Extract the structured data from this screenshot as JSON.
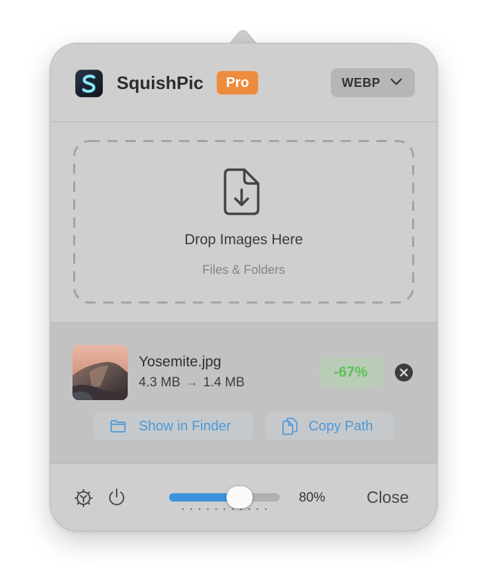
{
  "app": {
    "name": "SquishPic",
    "badge": "Pro",
    "icon": "squishpic-s-logo"
  },
  "format_menu": {
    "selected": "WEBP",
    "icon": "chevron-down-icon"
  },
  "drop_zone": {
    "icon": "document-download-icon",
    "title": "Drop Images Here",
    "subtitle": "Files & Folders"
  },
  "file": {
    "thumbnail": "mountain-photo-thumbnail",
    "name": "Yosemite.jpg",
    "original_size": "4.3 MB",
    "arrow": "→",
    "compressed_size": "1.4 MB",
    "reduction": "-67%"
  },
  "actions": {
    "show_in_finder": "Show in Finder",
    "copy_path": "Copy Path"
  },
  "footer": {
    "quality_value": 0.8,
    "quality_label": "80%",
    "close_label": "Close"
  },
  "colors": {
    "accent": "#3d93dc",
    "pro_badge": "#ee8c3e",
    "success": "#5ebf58",
    "panel": "#cfcfcf"
  }
}
